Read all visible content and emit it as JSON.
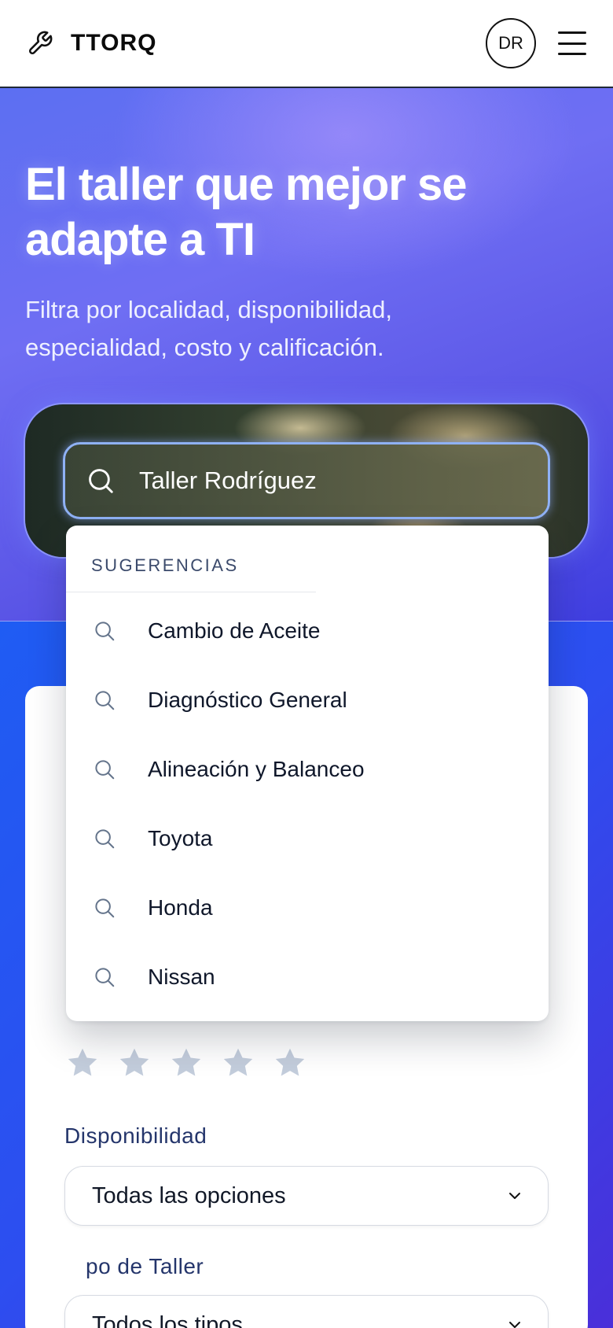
{
  "header": {
    "brand_name": "TTORQ",
    "brand_icon": "wrench-icon",
    "avatar_initials": "DR",
    "menu_icon": "hamburger-menu-icon"
  },
  "hero": {
    "title": "El taller que mejor se adapte a TI",
    "subtitle": "Filtra por localidad, disponibilidad, especialidad, costo y calificación."
  },
  "search": {
    "value": "Taller Rodríguez",
    "icon": "search-icon"
  },
  "suggestions": {
    "header": "SUGERENCIAS",
    "items": [
      {
        "label": "Cambio de Aceite"
      },
      {
        "label": "Diagnóstico General"
      },
      {
        "label": "Alineación y Balanceo"
      },
      {
        "label": "Toyota"
      },
      {
        "label": "Honda"
      },
      {
        "label": "Nissan"
      }
    ]
  },
  "filters": {
    "rating": {
      "max": 5,
      "selected": 0
    },
    "availability": {
      "label": "Disponibilidad",
      "value": "Todas las opciones"
    },
    "workshop_type": {
      "label": "po de Taller",
      "value": "Todos los tipos"
    }
  },
  "colors": {
    "hero_gradient_start": "#5c6ff2",
    "hero_gradient_end": "#3f3ee0",
    "lower_gradient_start": "#1f5cf3",
    "lower_gradient_end": "#4a2fd9",
    "search_border": "#8fb1f5",
    "star_inactive": "#c3cddc",
    "label_color": "#24356b"
  }
}
